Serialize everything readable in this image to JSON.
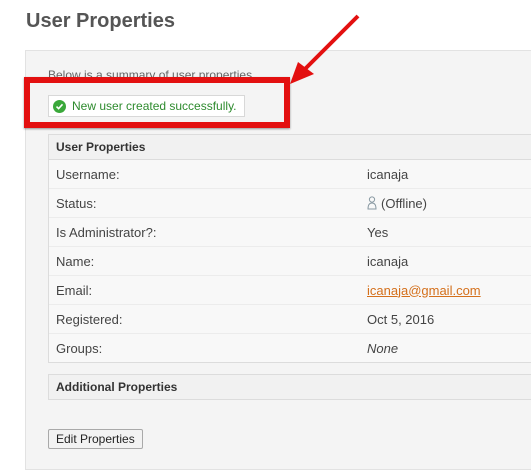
{
  "page": {
    "title": "User Properties"
  },
  "intro": {
    "text": "Below is a summary of user properties."
  },
  "notification": {
    "message": "New user created successfully.",
    "icon": "check-circle-icon",
    "color": "#3aa83a"
  },
  "annotation": {
    "highlight_color": "#e31010"
  },
  "properties": {
    "header": "User Properties",
    "rows": [
      {
        "label": "Username:",
        "value": "icanaja"
      },
      {
        "label": "Status:",
        "value": "(Offline)",
        "icon": "user-offline-icon"
      },
      {
        "label": "Is Administrator?:",
        "value": "Yes"
      },
      {
        "label": "Name:",
        "value": "icanaja"
      },
      {
        "label": "Email:",
        "value": "icanaja@gmail.com"
      },
      {
        "label": "Registered:",
        "value": "Oct 5, 2016"
      },
      {
        "label": "Groups:",
        "value": "None"
      }
    ]
  },
  "additional": {
    "header": "Additional Properties"
  },
  "actions": {
    "edit_label": "Edit Properties"
  }
}
